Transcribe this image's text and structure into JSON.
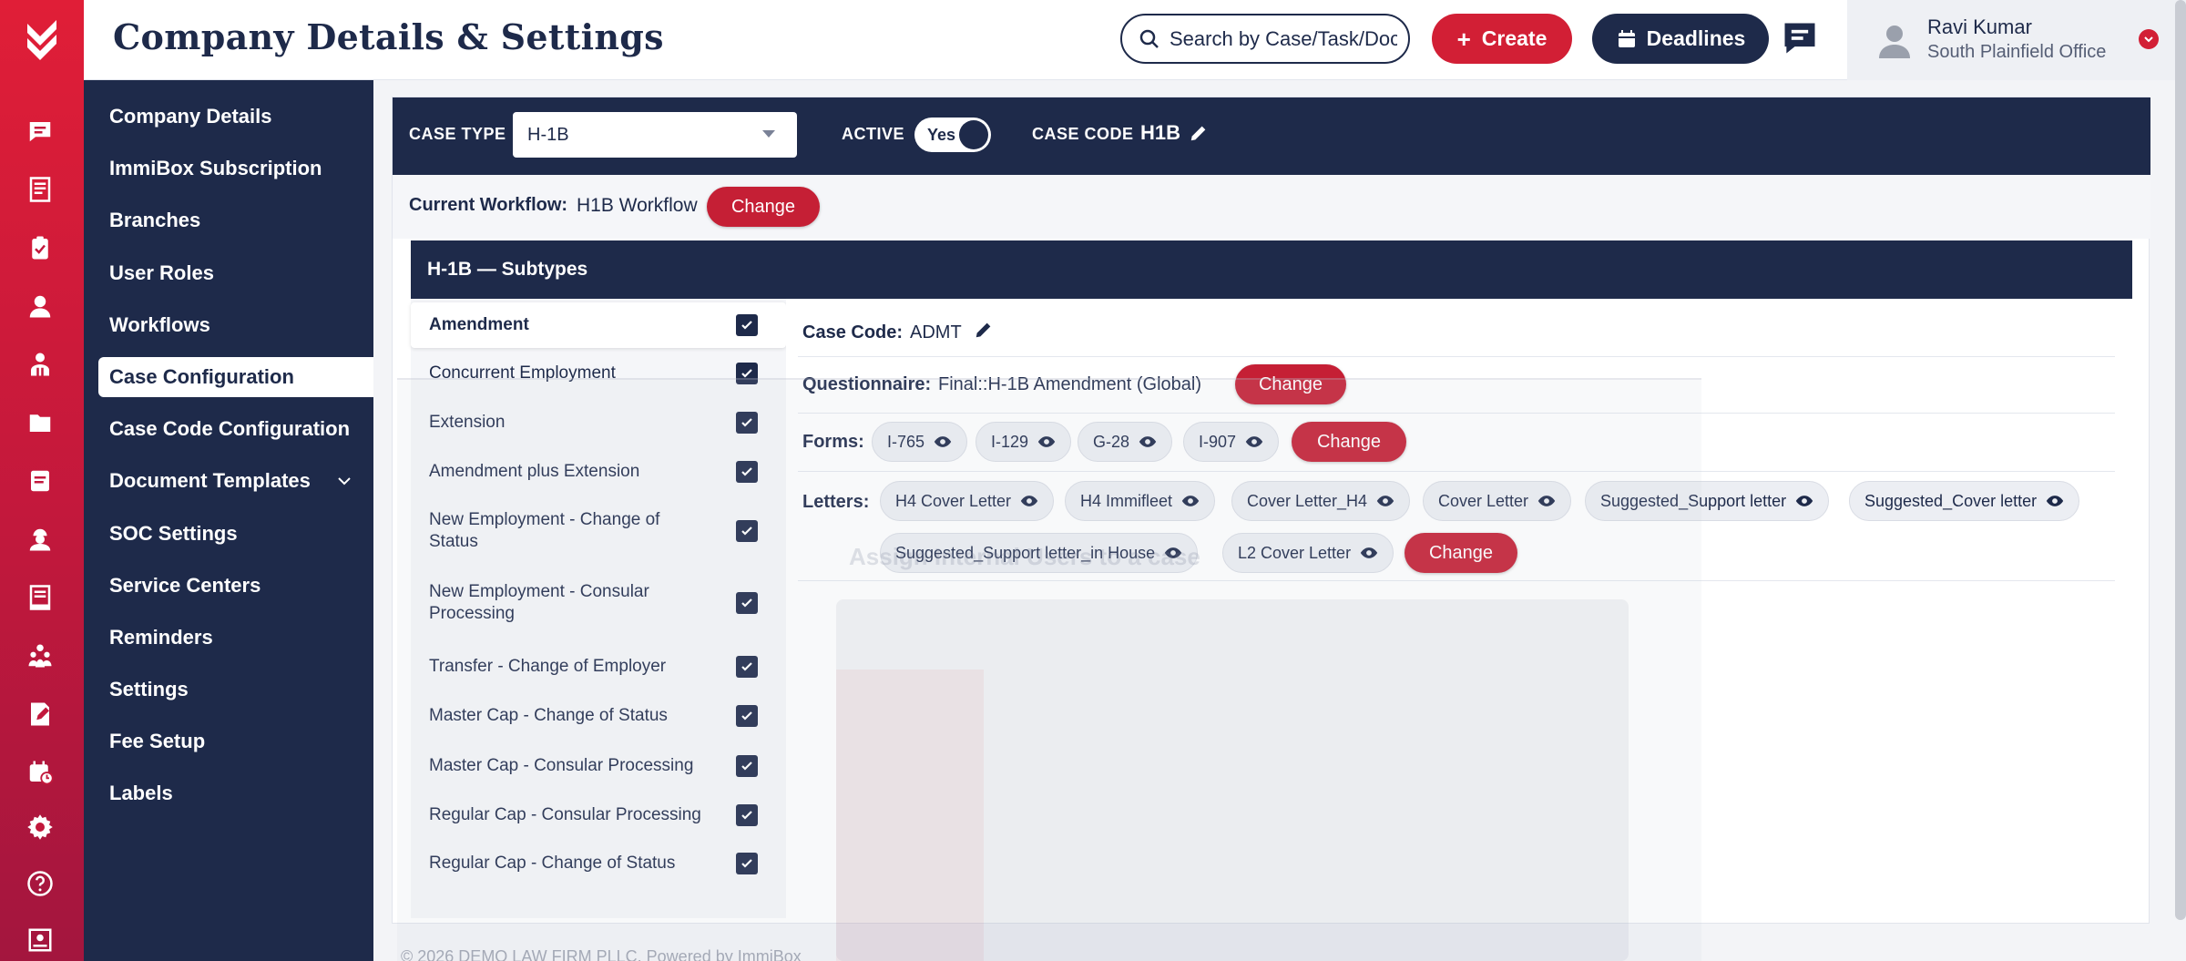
{
  "header": {
    "title": "Company Details & Settings",
    "search_placeholder": "Search by Case/Task/Document",
    "create_label": "Create",
    "deadlines_label": "Deadlines",
    "user_name": "Ravi Kumar",
    "user_office": "South Plainfield Office"
  },
  "settings_nav": {
    "items": [
      {
        "label": "Company Details"
      },
      {
        "label": "ImmiBox Subscription"
      },
      {
        "label": "Branches"
      },
      {
        "label": "User Roles"
      },
      {
        "label": "Workflows"
      },
      {
        "label": "Case Configuration",
        "active": true
      },
      {
        "label": "Case Code Configuration"
      },
      {
        "label": "Document Templates"
      },
      {
        "label": "SOC Settings"
      },
      {
        "label": "Service Centers"
      },
      {
        "label": "Reminders"
      },
      {
        "label": "Settings"
      },
      {
        "label": "Fee Setup"
      },
      {
        "label": "Labels"
      }
    ]
  },
  "case_config": {
    "case_type_label": "CASE TYPE",
    "case_type_value": "H-1B",
    "active_label": "ACTIVE",
    "active_value": "Yes",
    "case_code_label": "CASE CODE",
    "case_code_value": "H1B",
    "workflow_label": "Current Workflow:",
    "workflow_value": "H1B Workflow",
    "change_label": "Change",
    "subtypes_title": "H-1B — Subtypes"
  },
  "subtypes": [
    {
      "label": "Amendment",
      "checked": true,
      "active": true
    },
    {
      "label": "Concurrent Employment",
      "checked": true
    },
    {
      "label": "Extension",
      "checked": true
    },
    {
      "label": "Amendment plus Extension",
      "checked": true
    },
    {
      "label": "New Employment - Change of Status",
      "checked": true
    },
    {
      "label": "New Employment - Consular Processing",
      "checked": true
    },
    {
      "label": "Transfer - Change of Employer",
      "checked": true
    },
    {
      "label": "Master Cap - Change of Status",
      "checked": true
    },
    {
      "label": "Master Cap - Consular Processing",
      "checked": true
    },
    {
      "label": "Regular Cap - Consular Processing",
      "checked": true
    },
    {
      "label": "Regular Cap - Change of Status",
      "checked": true
    }
  ],
  "details": {
    "case_code_label": "Case Code:",
    "case_code_value": "ADMT",
    "questionnaire_label": "Questionnaire:",
    "questionnaire_value": "Final::H-1B Amendment (Global)",
    "forms_label": "Forms:",
    "forms": [
      "I-765",
      "I-129",
      "G-28",
      "I-907"
    ],
    "letters_label": "Letters:",
    "letters": [
      "H4 Cover Letter",
      "H4 Immifleet",
      "Cover Letter_H4",
      "Cover Letter",
      "Suggested_Support letter",
      "Suggested_Cover letter",
      "Suggested_Support letter_in House",
      "L2 Cover Letter"
    ],
    "change_label": "Change"
  },
  "overlay": {
    "caption": "Assign Internal Users to a case"
  },
  "footer": {
    "text": "© 2026 DEMO LAW FIRM PLLC. Powered by ImmiBox"
  },
  "colors": {
    "brand_red": "#d21f35",
    "navy": "#1e2a4a"
  }
}
